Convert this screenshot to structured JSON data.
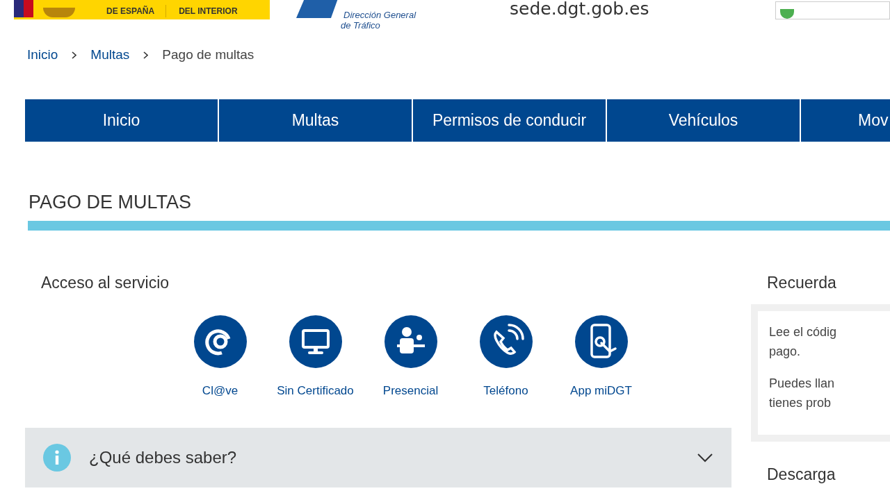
{
  "header": {
    "ministry_lines": [
      "DE ESPAÑA",
      "DEL INTERIOR"
    ],
    "agency_lines": [
      "Dirección General",
      "de Tráfico"
    ],
    "site": "sede.dgt.gob.es"
  },
  "breadcrumb": [
    {
      "label": "Inicio",
      "link": true
    },
    {
      "label": "Multas",
      "link": true
    },
    {
      "label": "Pago de multas",
      "link": false
    }
  ],
  "nav": [
    "Inicio",
    "Multas",
    "Permisos de conducir",
    "Vehículos",
    "Mov"
  ],
  "title": "PAGO DE MULTAS",
  "access": {
    "heading": "Acceso al servicio",
    "options": [
      {
        "kind": "clave",
        "label": "Cl@ve"
      },
      {
        "kind": "computer",
        "label": "Sin Certificado"
      },
      {
        "kind": "desk",
        "label": "Presencial"
      },
      {
        "kind": "phone",
        "label": "Teléfono"
      },
      {
        "kind": "app",
        "label": "App miDGT"
      }
    ]
  },
  "accordion": {
    "title": "¿Qué debes saber?",
    "expanded": false
  },
  "sidebar": {
    "heading": "Recuerda",
    "paragraphs": [
      [
        "Lee el códig",
        "pago."
      ],
      [
        "Puedes llan",
        "tienes prob"
      ]
    ],
    "heading_2": "Descarga"
  }
}
